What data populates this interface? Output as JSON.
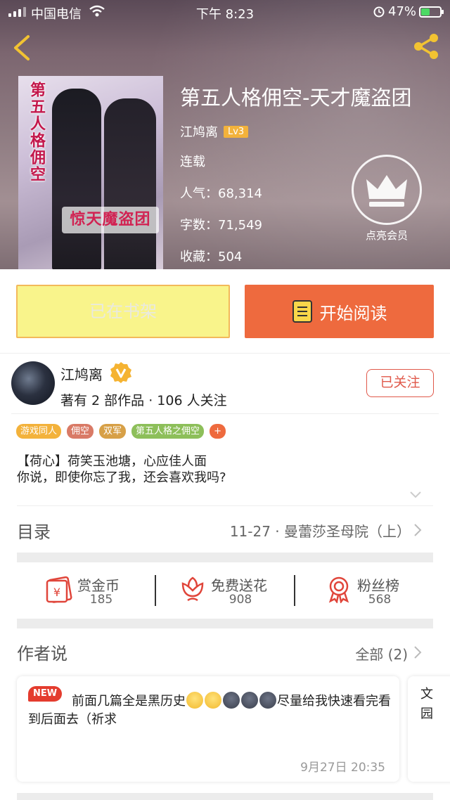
{
  "status_bar": {
    "carrier": "中国电信",
    "time": "下午 8:23",
    "battery_pct": "47%",
    "battery_level": 0.47
  },
  "book": {
    "title": "第五人格佣空-天才魔盗团",
    "author": "江鸠离",
    "author_level": "Lv3",
    "status": "连载",
    "popularity_label": "人气：",
    "popularity": "68,314",
    "words_label": "字数：",
    "words": "71,549",
    "favorites_label": "收藏：",
    "favorites": "504",
    "cover_vertical_title": "第五人格佣空",
    "cover_banner": "惊天魔盗团"
  },
  "vip": {
    "label": "点亮会员"
  },
  "actions": {
    "shelf_label": "已在书架",
    "read_label": "开始阅读"
  },
  "author": {
    "name": "江鸠离",
    "stats": "著有 2 部作品 · 106 人关注",
    "follow_label": "已关注"
  },
  "tags": [
    {
      "label": "游戏同人",
      "color": "#f3b23b"
    },
    {
      "label": "佣空",
      "color": "#d97a66"
    },
    {
      "label": "双军",
      "color": "#d7a047"
    },
    {
      "label": "第五人格之佣空",
      "color": "#8dbf5a"
    },
    {
      "label": "+",
      "color": "#ee6a3e"
    }
  ],
  "description": {
    "line1": "【荷心】荷笑玉池塘，心应佳人面",
    "line2": "你说，即使你忘了我，还会喜欢我吗?"
  },
  "toc": {
    "label": "目录",
    "latest": "11-27 · 曼蕾莎圣母院（上）"
  },
  "stats": [
    {
      "label": "赏金币",
      "value": "185",
      "icon": "red-envelope-icon"
    },
    {
      "label": "免费送花",
      "value": "908",
      "icon": "flower-icon"
    },
    {
      "label": "粉丝榜",
      "value": "568",
      "icon": "medal-icon"
    }
  ],
  "author_says": {
    "label": "作者说",
    "all_label": "全部 (2)",
    "cards": [
      {
        "badge": "NEW",
        "text_part1": "前面几篇全是黑历史",
        "text_part2": "尽量给我快速看完看到后面去（祈求",
        "time": "9月27日  20:35"
      },
      {
        "text": "文园"
      }
    ]
  }
}
